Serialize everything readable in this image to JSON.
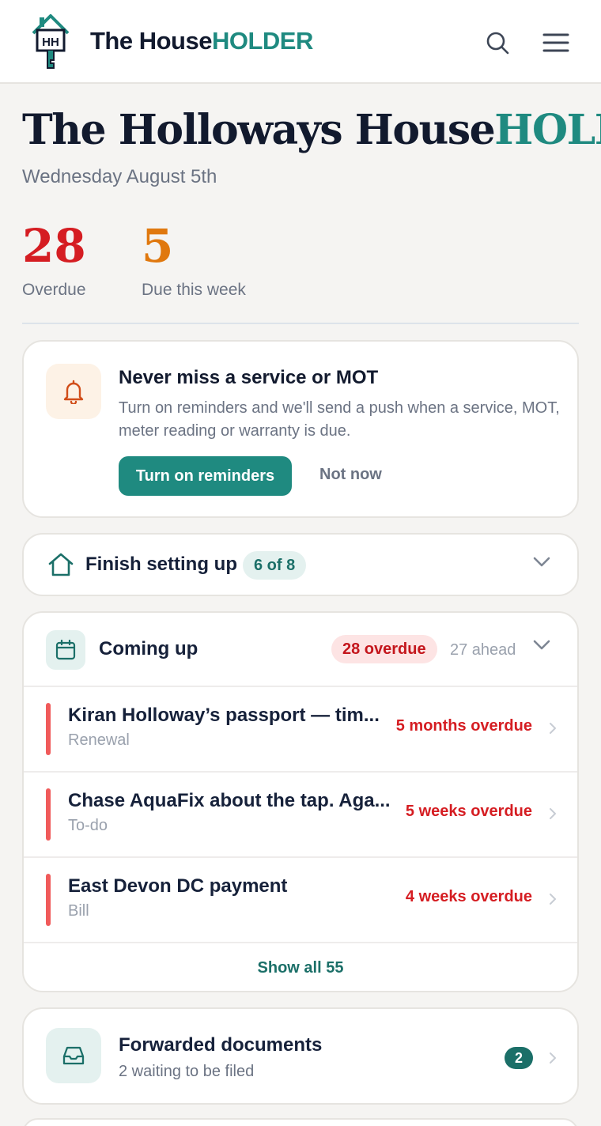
{
  "header": {
    "brand_prefix": "The House",
    "brand_highlight": "HOLDER",
    "logo_letters": "HH"
  },
  "page": {
    "title_prefix": "The Holloways House",
    "title_highlight": "HOLD",
    "date": "Wednesday August 5th"
  },
  "stats": {
    "overdue_count": "28",
    "overdue_label": "Overdue",
    "due_week_count": "5",
    "due_week_label": "Due this week"
  },
  "reminder_card": {
    "title": "Never miss a service or MOT",
    "text": "Turn on reminders and we'll send a push when a service, MOT, meter reading or warranty is due.",
    "primary_label": "Turn on reminders",
    "secondary_label": "Not now"
  },
  "setup_card": {
    "title": "Finish setting up",
    "progress": "6 of 8"
  },
  "coming_up": {
    "title": "Coming up",
    "overdue_pill": "28 overdue",
    "ahead": "27 ahead",
    "items": [
      {
        "title": "Kiran Holloway’s passport — tim...",
        "type": "Renewal",
        "status": "5 months overdue"
      },
      {
        "title": "Chase AquaFix about the tap. Aga...",
        "type": "To-do",
        "status": "5 weeks overdue"
      },
      {
        "title": "East Devon DC payment",
        "type": "Bill",
        "status": "4 weeks overdue"
      }
    ],
    "show_all": "Show all 55"
  },
  "forwarded": {
    "title": "Forwarded documents",
    "subtitle": "2 waiting to be filed",
    "count": "2"
  },
  "colors": {
    "brand_teal": "#1f8a80",
    "overdue_red": "#d51d22",
    "due_orange": "#e0780e",
    "background": "#f5f4f2"
  }
}
